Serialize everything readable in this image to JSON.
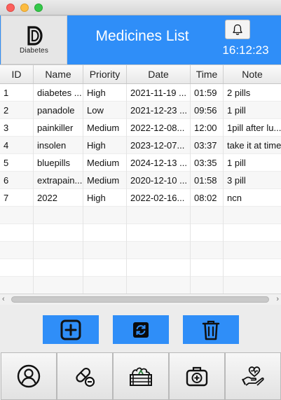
{
  "app": {
    "logo_text": "Diabetes",
    "title": "Medicines List",
    "clock": "16:12:23"
  },
  "table": {
    "columns": [
      "ID",
      "Name",
      "Priority",
      "Date",
      "Time",
      "Note"
    ],
    "rows": [
      {
        "id": "1",
        "name": "diabetes ...",
        "priority": "High",
        "date": "2021-11-19 ...",
        "time": "01:59",
        "note": "2 pills"
      },
      {
        "id": "2",
        "name": "panadole",
        "priority": "Low",
        "date": "2021-12-23 ...",
        "time": "09:56",
        "note": "1 pill"
      },
      {
        "id": "3",
        "name": "painkiller",
        "priority": "Medium",
        "date": "2022-12-08...",
        "time": "12:00",
        "note": "1pill after lu..."
      },
      {
        "id": "4",
        "name": "insolen",
        "priority": "High",
        "date": "2023-12-07...",
        "time": "03:37",
        "note": "take it at time"
      },
      {
        "id": "5",
        "name": "bluepills",
        "priority": "Medium",
        "date": "2024-12-13 ...",
        "time": "03:35",
        "note": "1 pill"
      },
      {
        "id": "6",
        "name": "extrapain...",
        "priority": "Medium",
        "date": "2020-12-10 ...",
        "time": "01:58",
        "note": "3 pill"
      },
      {
        "id": "7",
        "name": "2022",
        "priority": "High",
        "date": "2022-02-16...",
        "time": "08:02",
        "note": "ncn"
      }
    ]
  },
  "icons": {
    "bell": "bell-icon",
    "add": "plus-square-icon",
    "refresh": "refresh-icon",
    "delete": "trash-icon",
    "nav": [
      "user-circle-icon",
      "pill-icon",
      "food-crate-icon",
      "medical-kit-icon",
      "heart-hand-icon"
    ]
  },
  "colors": {
    "accent": "#2f8ef8",
    "header_text": "#ffffff"
  }
}
